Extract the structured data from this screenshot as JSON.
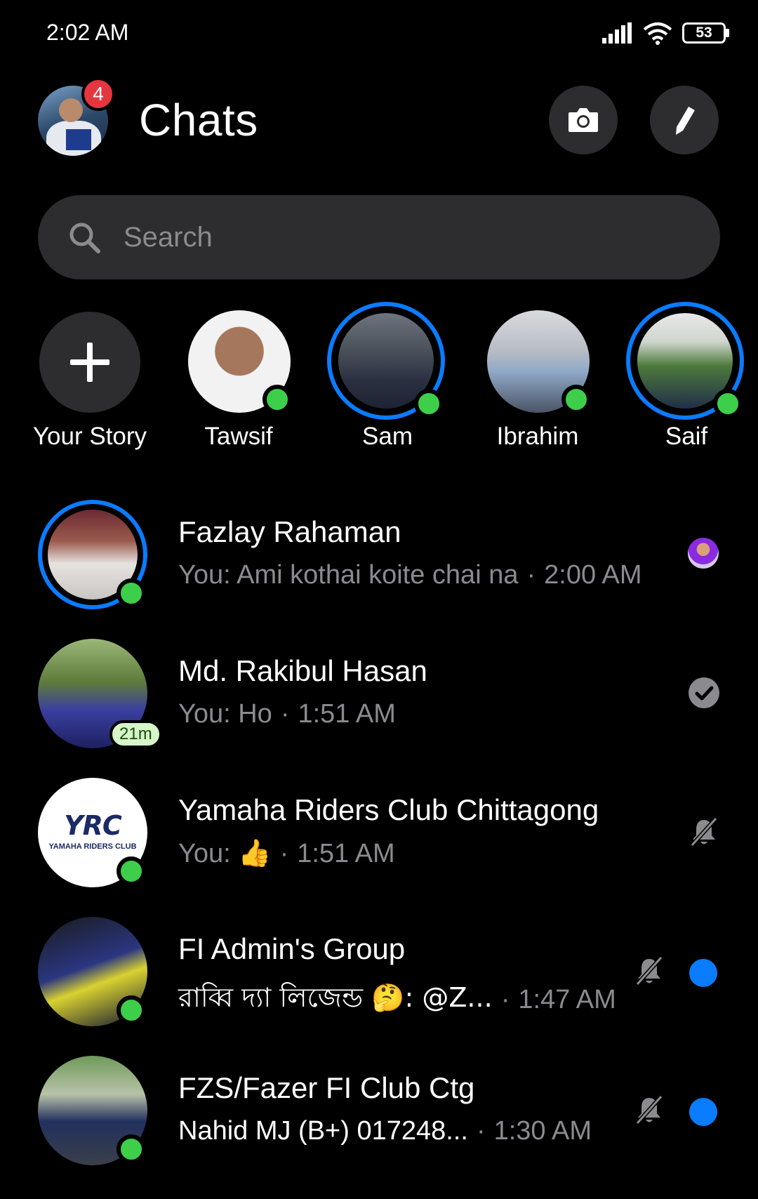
{
  "status_bar": {
    "time": "2:02 AM",
    "battery": "53"
  },
  "header": {
    "title": "Chats",
    "notification_count": "4"
  },
  "search": {
    "placeholder": "Search"
  },
  "stories": [
    {
      "name": "Your Story"
    },
    {
      "name": "Tawsif"
    },
    {
      "name": "Sam"
    },
    {
      "name": "Ibrahim"
    },
    {
      "name": "Saif"
    }
  ],
  "chats": [
    {
      "name": "Fazlay Rahaman",
      "preview": "You: Ami kothai koite chai na",
      "time": "2:00 AM"
    },
    {
      "name": "Md. Rakibul Hasan",
      "preview": "You: Ho",
      "time": "1:51 AM",
      "active_badge": "21m"
    },
    {
      "name": "Yamaha Riders Club Chittagong",
      "preview": "You: 👍",
      "time": "1:51 AM",
      "avatar_text": "YRC",
      "avatar_subtext": "YAMAHA RIDERS CLUB"
    },
    {
      "name": "FI Admin's Group",
      "preview": "রাব্বি দ্যা লিজেন্ড 🤔: @Z...",
      "time": "1:47 AM"
    },
    {
      "name": "FZS/Fazer FI Club Ctg",
      "preview": "Nahid MJ (B+) 017248...",
      "time": "1:30 AM"
    }
  ],
  "colors": {
    "accent": "#0a7cff",
    "online": "#3ecf4a",
    "badge": "#e5363f",
    "surface": "#2d2d2f",
    "secondary_text": "#8b8b8f"
  }
}
